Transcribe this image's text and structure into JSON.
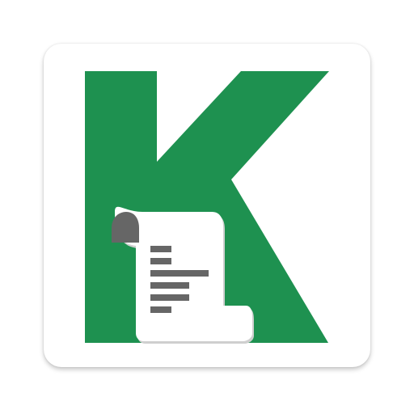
{
  "app_icon": {
    "name": "K",
    "colors": {
      "tile": "#ffffff",
      "letter": "#1e9150",
      "scroll": "#ffffff",
      "scroll_shadow": "#c8c8c8",
      "bars": "#666666"
    },
    "icons": [
      "k-letter-icon",
      "scroll-icon",
      "text-lines-icon"
    ]
  }
}
